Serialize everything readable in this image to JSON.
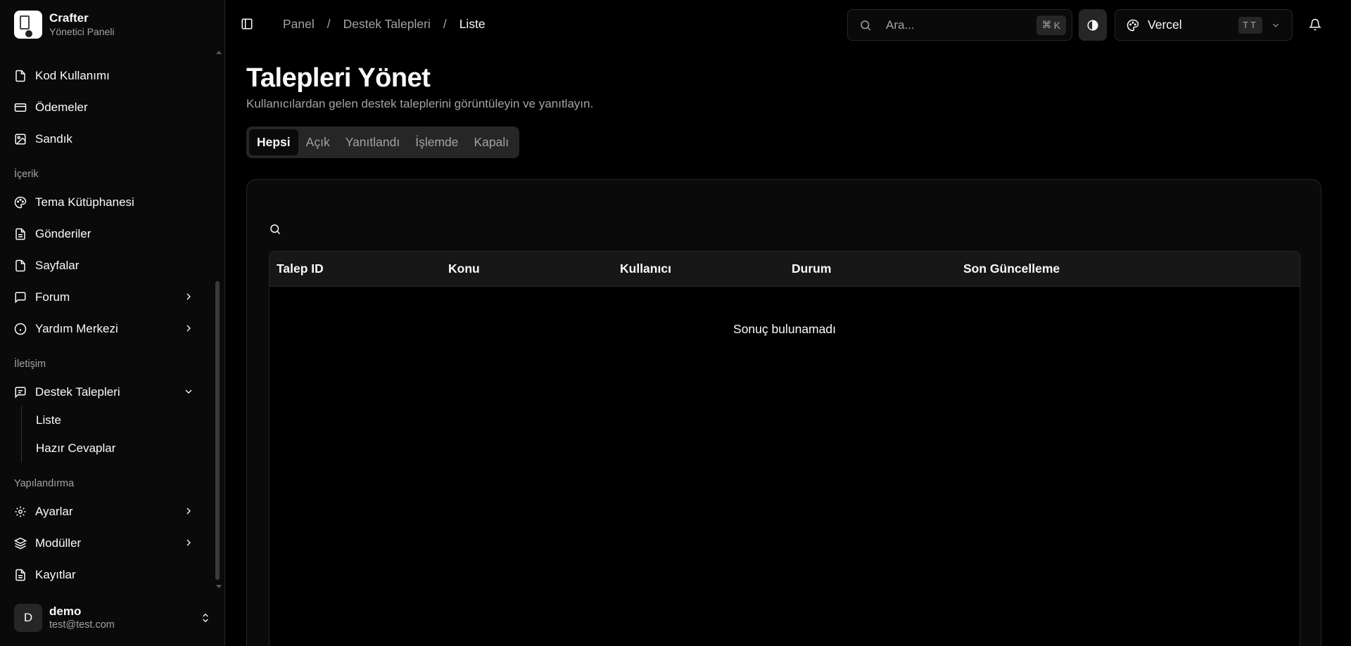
{
  "brand": {
    "title": "Crafter",
    "subtitle": "Yönetici Paneli"
  },
  "sidebar": {
    "items_top": [
      {
        "label": "Kod Kullanımı",
        "icon": "file-pdf-icon"
      },
      {
        "label": "Ödemeler",
        "icon": "credit-card-icon"
      },
      {
        "label": "Sandık",
        "icon": "image-icon"
      }
    ],
    "section_content": "İçerik",
    "items_content": [
      {
        "label": "Tema Kütüphanesi",
        "icon": "palette-icon"
      },
      {
        "label": "Gönderiler",
        "icon": "document-icon"
      },
      {
        "label": "Sayfalar",
        "icon": "file-icon"
      },
      {
        "label": "Forum",
        "icon": "message-icon"
      },
      {
        "label": "Yardım Merkezi",
        "icon": "info-icon"
      }
    ],
    "section_comm": "İletişim",
    "support": {
      "label": "Destek Talepleri",
      "icon": "message-icon",
      "subitems": [
        "Liste",
        "Hazır Cevaplar"
      ]
    },
    "section_config": "Yapılandırma",
    "items_config": [
      {
        "label": "Ayarlar",
        "icon": "gear-icon"
      },
      {
        "label": "Modüller",
        "icon": "layers-icon"
      },
      {
        "label": "Kayıtlar",
        "icon": "document-icon"
      }
    ]
  },
  "user": {
    "initial": "D",
    "name": "demo",
    "email": "test@test.com"
  },
  "header": {
    "breadcrumb": [
      "Panel",
      "Destek Talepleri",
      "Liste"
    ],
    "search_placeholder": "Ara...",
    "search_shortcut_symbol": "⌘",
    "search_shortcut_key": "K",
    "theme_name": "Vercel",
    "theme_badge": "TT"
  },
  "page": {
    "title": "Talepleri Yönet",
    "subtitle": "Kullanıcılardan gelen destek taleplerini görüntüleyin ve yanıtlayın.",
    "tabs": [
      "Hepsi",
      "Açık",
      "Yanıtlandı",
      "İşlemde",
      "Kapalı"
    ],
    "active_tab": "Hepsi"
  },
  "table": {
    "columns": [
      "Talep ID",
      "Konu",
      "Kullanıcı",
      "Durum",
      "Son Güncelleme"
    ],
    "empty_text": "Sonuç bulunamadı"
  }
}
